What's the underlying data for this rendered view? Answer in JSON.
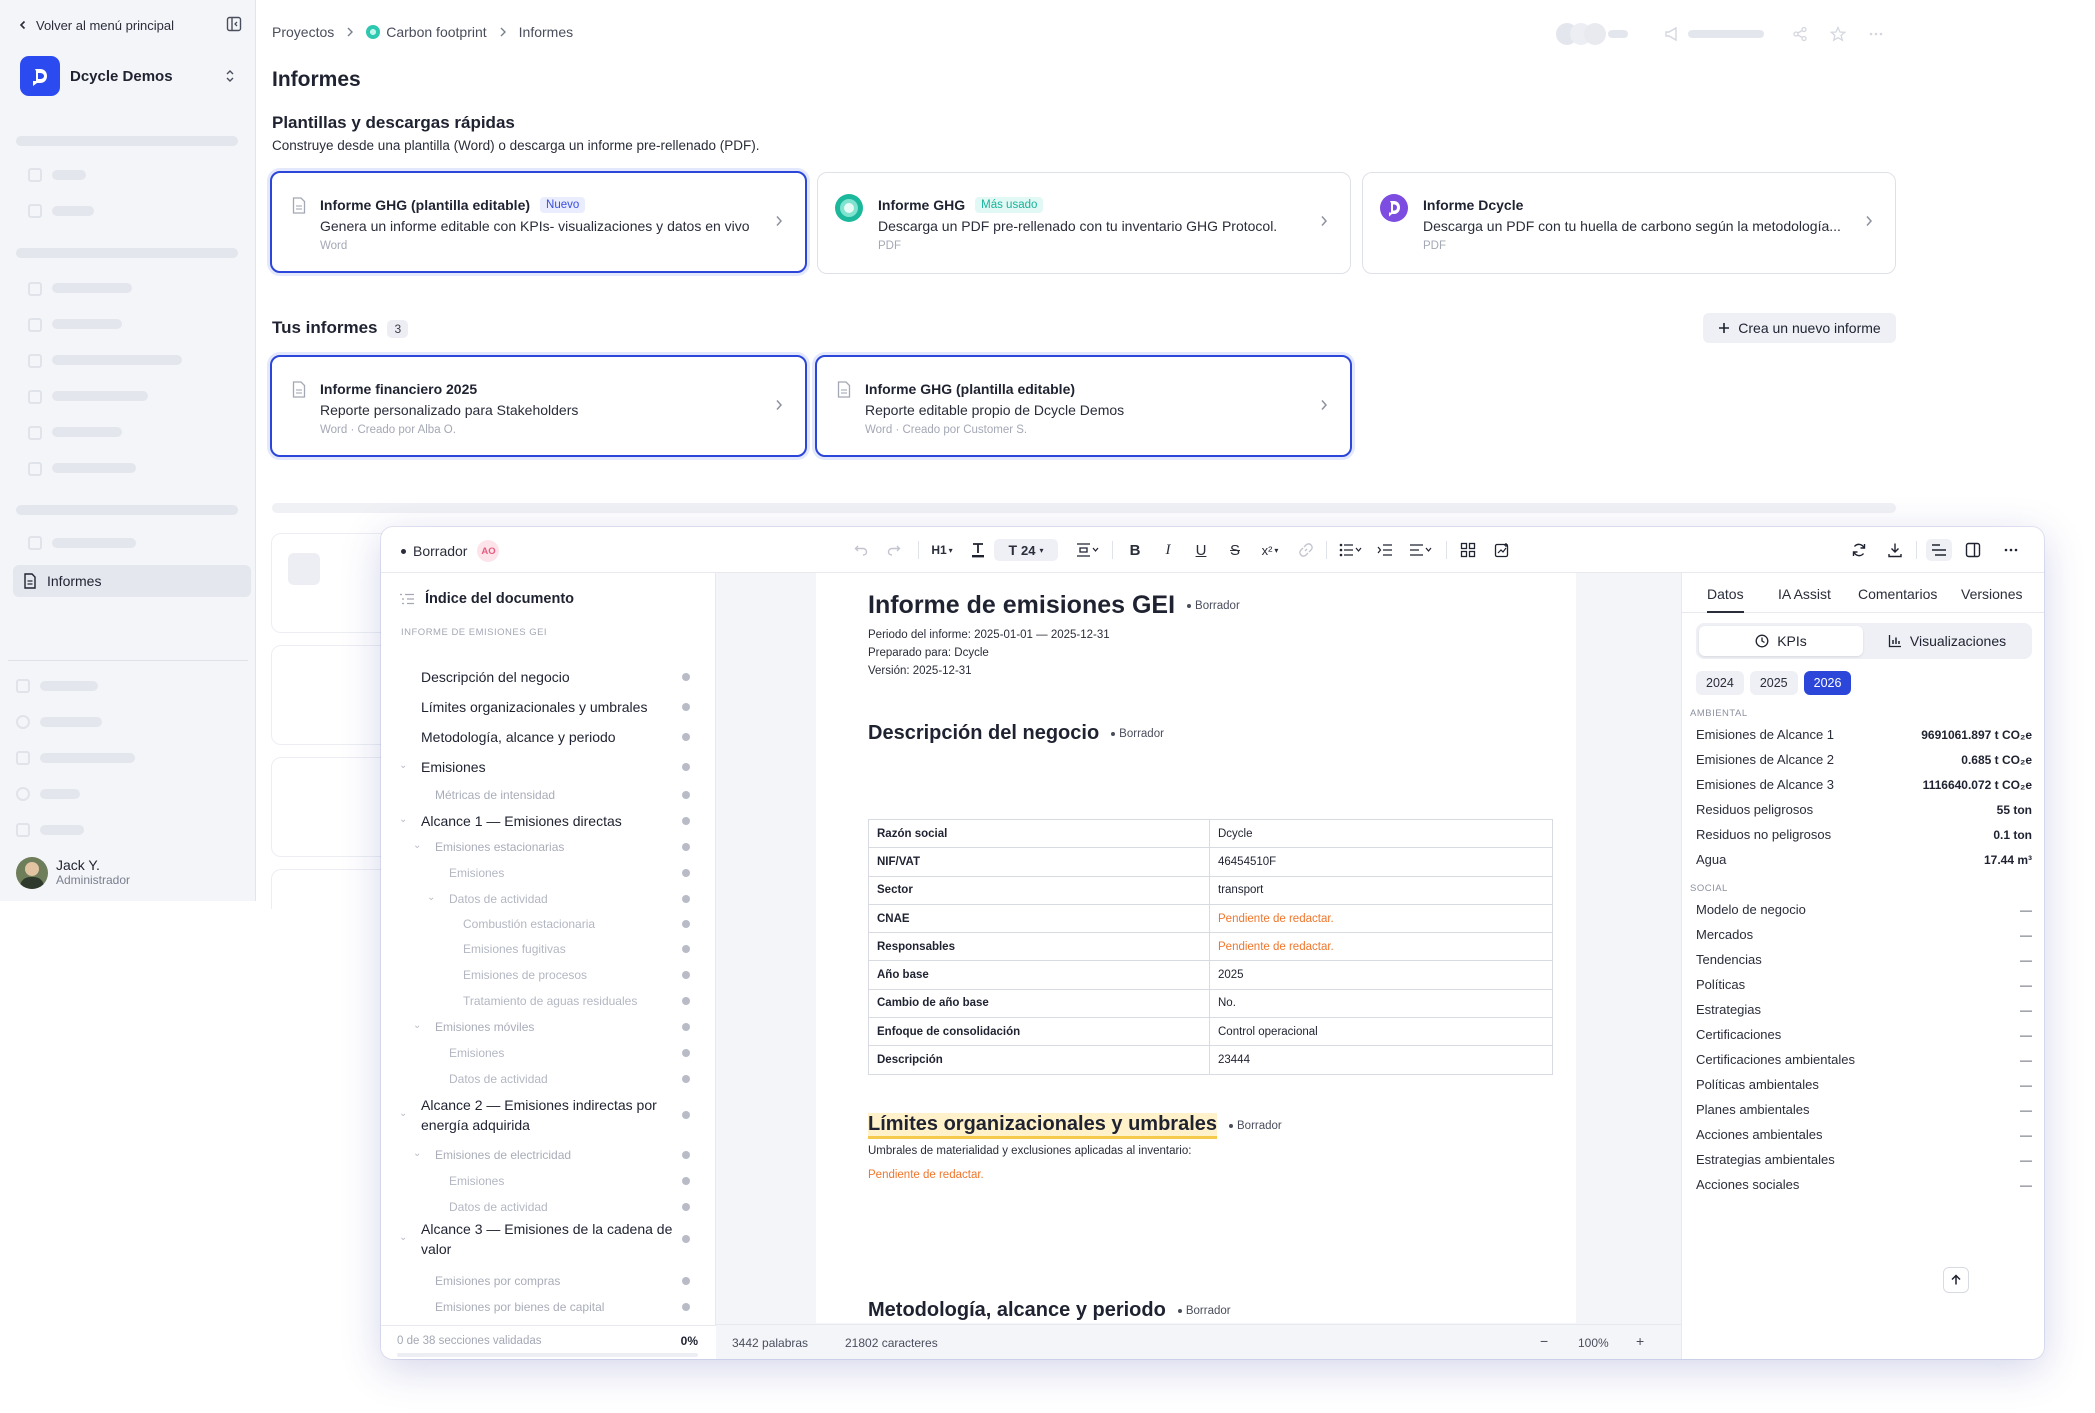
{
  "sidebar": {
    "back_label": "Volver al menú principal",
    "org_name": "Dcycle Demos",
    "active_item": "Informes",
    "user_name": "Jack Y.",
    "user_role": "Administrador"
  },
  "breadcrumb": {
    "items": [
      "Proyectos",
      "Carbon footprint",
      "Informes"
    ]
  },
  "page": {
    "title": "Informes"
  },
  "templates": {
    "title": "Plantillas y descargas rápidas",
    "subtitle": "Construye desde una plantilla (Word) o descarga un informe pre-rellenado (PDF).",
    "cards": [
      {
        "title": "Informe GHG (plantilla editable)",
        "badge": "Nuevo",
        "description": "Genera un informe editable con KPIs- visualizaciones y datos en vivo",
        "meta": "Word"
      },
      {
        "title": "Informe GHG",
        "badge": "Más usado",
        "description": "Descarga un PDF pre-rellenado con tu inventario GHG Protocol.",
        "meta": "PDF"
      },
      {
        "title": "Informe Dcycle",
        "badge": "",
        "description": "Descarga un PDF con tu huella de carbono según la metodología...",
        "meta": "PDF"
      }
    ]
  },
  "your_reports": {
    "title": "Tus informes",
    "count": "3",
    "new_button": "Crea un nuevo informe",
    "cards": [
      {
        "title": "Informe financiero 2025",
        "description": "Reporte personalizado para Stakeholders",
        "meta": "Word · Creado por Alba O."
      },
      {
        "title": "Informe GHG (plantilla editable)",
        "description": "Reporte editable propio de Dcycle Demos",
        "meta": "Word · Creado por Customer S."
      }
    ]
  },
  "editor": {
    "status": "Borrador",
    "collaborator_initials": "AO",
    "heading_level": "H1",
    "font_size": "24",
    "outline": {
      "title": "Índice del documento",
      "caption": "INFORME DE EMISIONES GEI",
      "items": [
        {
          "label": "Descripción del negocio"
        },
        {
          "label": "Límites organizacionales y umbrales"
        },
        {
          "label": "Metodología, alcance y periodo"
        },
        {
          "label": "Emisiones"
        },
        {
          "label": "Métricas de intensidad"
        },
        {
          "label": "Alcance 1 — Emisiones directas"
        },
        {
          "label": "Emisiones estacionarias"
        },
        {
          "label": "Emisiones"
        },
        {
          "label": "Datos de actividad"
        },
        {
          "label": "Combustión estacionaria"
        },
        {
          "label": "Emisiones fugitivas"
        },
        {
          "label": "Emisiones de procesos"
        },
        {
          "label": "Tratamiento de aguas residuales"
        },
        {
          "label": "Emisiones móviles"
        },
        {
          "label": "Emisiones"
        },
        {
          "label": "Datos de actividad"
        },
        {
          "label": "Alcance 2 — Emisiones indirectas por energía adquirida"
        },
        {
          "label": "Emisiones de electricidad"
        },
        {
          "label": "Emisiones"
        },
        {
          "label": "Datos de actividad"
        },
        {
          "label": "Alcance 3 — Emisiones de la cadena de valor"
        },
        {
          "label": "Emisiones por compras"
        },
        {
          "label": "Emisiones por bienes de capital"
        }
      ],
      "progress_text": "0 de 38 secciones validadas",
      "progress_value": "0%"
    },
    "document": {
      "title": "Informe de emisiones GEI",
      "title_status": "Borrador",
      "period": "Periodo del informe: 2025-01-01 — 2025-12-31",
      "prepared_for": "Preparado para: Dcycle",
      "version": "Versión: 2025-12-31",
      "section1_title": "Descripción del negocio",
      "section1_status": "Borrador",
      "table": [
        {
          "key": "Razón social",
          "value": "Dcycle"
        },
        {
          "key": "NIF/VAT",
          "value": "46454510F"
        },
        {
          "key": "Sector",
          "value": "transport"
        },
        {
          "key": "CNAE",
          "value": "Pendiente de redactar."
        },
        {
          "key": "Responsables",
          "value": "Pendiente de redactar."
        },
        {
          "key": "Año base",
          "value": "2025"
        },
        {
          "key": "Cambio de año base",
          "value": "No."
        },
        {
          "key": "Enfoque de consolidación",
          "value": "Control operacional"
        },
        {
          "key": "Descripción",
          "value": "23444"
        }
      ],
      "section2_title": "Límites organizacionales y umbrales",
      "section2_status": "Borrador",
      "section2_text": "Umbrales de materialidad y exclusiones aplicadas al inventario:",
      "section2_pending": "Pendiente de redactar.",
      "section3_title": "Metodología, alcance y periodo",
      "section3_status": "Borrador"
    },
    "statusbar": {
      "words": "3442 palabras",
      "chars": "21802 caracteres",
      "zoom": "100%"
    },
    "panel": {
      "tabs": [
        "Datos",
        "IA Assist",
        "Comentarios",
        "Versiones"
      ],
      "segments": [
        "KPIs",
        "Visualizaciones"
      ],
      "years": [
        "2024",
        "2025",
        "2026"
      ],
      "selected_year": "2026",
      "env_caption": "AMBIENTAL",
      "env": [
        {
          "name": "Emisiones de Alcance 1",
          "value": "9691061.897 t CO₂e"
        },
        {
          "name": "Emisiones de Alcance 2",
          "value": "0.685 t CO₂e"
        },
        {
          "name": "Emisiones de Alcance 3",
          "value": "1116640.072 t CO₂e"
        },
        {
          "name": "Residuos peligrosos",
          "value": "55 ton"
        },
        {
          "name": "Residuos no peligrosos",
          "value": "0.1 ton"
        },
        {
          "name": "Agua",
          "value": "17.44 m³"
        }
      ],
      "social_caption": "SOCIAL",
      "social": [
        {
          "name": "Modelo de negocio",
          "value": "—"
        },
        {
          "name": "Mercados",
          "value": "—"
        },
        {
          "name": "Tendencias",
          "value": "—"
        },
        {
          "name": "Políticas",
          "value": "—"
        },
        {
          "name": "Estrategias",
          "value": "—"
        },
        {
          "name": "Certificaciones",
          "value": "—"
        },
        {
          "name": "Certificaciones ambientales",
          "value": "—"
        },
        {
          "name": "Políticas ambientales",
          "value": "—"
        },
        {
          "name": "Planes ambientales",
          "value": "—"
        },
        {
          "name": "Acciones ambientales",
          "value": "—"
        },
        {
          "name": "Estrategias ambientales",
          "value": "—"
        },
        {
          "name": "Acciones sociales",
          "value": "—"
        }
      ]
    }
  }
}
